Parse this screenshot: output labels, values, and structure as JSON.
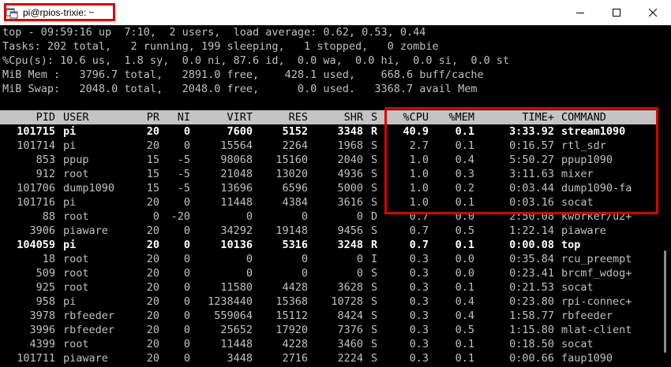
{
  "window": {
    "title": "pi@rpios-trixie: ~",
    "icons": {
      "app": "terminal-app-icon",
      "minimize": "minimize-icon",
      "maximize": "maximize-icon",
      "close": "close-icon"
    }
  },
  "summary": [
    "top - 09:59:16 up  7:10,  2 users,  load average: 0.62, 0.53, 0.44",
    "Tasks: 202 total,   2 running, 199 sleeping,   1 stopped,   0 zombie",
    "%Cpu(s): 10.6 us,  1.8 sy,  0.0 ni, 87.6 id,  0.0 wa,  0.0 hi,  0.0 si,  0.0 st",
    "MiB Mem :   3796.7 total,   2891.0 free,    428.1 used,    668.6 buff/cache",
    "MiB Swap:   2048.0 total,   2048.0 free,      0.0 used.   3368.7 avail Mem"
  ],
  "table": {
    "columns": [
      "PID",
      "USER",
      "PR",
      "NI",
      "VIRT",
      "RES",
      "SHR",
      "S",
      "%CPU",
      "%MEM",
      "TIME+",
      "COMMAND"
    ],
    "rows": [
      {
        "pid": "101715",
        "user": "pi",
        "pr": "20",
        "ni": "0",
        "virt": "7600",
        "res": "5152",
        "shr": "3348",
        "s": "R",
        "cpu": "40.9",
        "mem": "0.1",
        "time": "3:33.92",
        "cmd": "stream1090",
        "bold": true
      },
      {
        "pid": "101714",
        "user": "pi",
        "pr": "20",
        "ni": "0",
        "virt": "15564",
        "res": "2264",
        "shr": "1968",
        "s": "S",
        "cpu": "2.7",
        "mem": "0.1",
        "time": "0:16.57",
        "cmd": "rtl_sdr",
        "bold": false
      },
      {
        "pid": "853",
        "user": "ppup",
        "pr": "15",
        "ni": "-5",
        "virt": "98068",
        "res": "15160",
        "shr": "2040",
        "s": "S",
        "cpu": "1.0",
        "mem": "0.4",
        "time": "5:50.27",
        "cmd": "ppup1090",
        "bold": false
      },
      {
        "pid": "912",
        "user": "root",
        "pr": "15",
        "ni": "-5",
        "virt": "21048",
        "res": "13020",
        "shr": "4936",
        "s": "S",
        "cpu": "1.0",
        "mem": "0.3",
        "time": "3:11.63",
        "cmd": "mixer",
        "bold": false
      },
      {
        "pid": "101706",
        "user": "dump1090",
        "pr": "15",
        "ni": "-5",
        "virt": "13696",
        "res": "6596",
        "shr": "5000",
        "s": "S",
        "cpu": "1.0",
        "mem": "0.2",
        "time": "0:03.44",
        "cmd": "dump1090-fa",
        "bold": false
      },
      {
        "pid": "101716",
        "user": "pi",
        "pr": "20",
        "ni": "0",
        "virt": "11448",
        "res": "4384",
        "shr": "3616",
        "s": "S",
        "cpu": "1.0",
        "mem": "0.1",
        "time": "0:03.16",
        "cmd": "socat",
        "bold": false
      },
      {
        "pid": "88",
        "user": "root",
        "pr": "0",
        "ni": "-20",
        "virt": "0",
        "res": "0",
        "shr": "0",
        "s": "D",
        "cpu": "0.7",
        "mem": "0.0",
        "time": "2:50.08",
        "cmd": "kworker/u2+",
        "bold": false
      },
      {
        "pid": "3906",
        "user": "piaware",
        "pr": "20",
        "ni": "0",
        "virt": "34292",
        "res": "19148",
        "shr": "9456",
        "s": "S",
        "cpu": "0.7",
        "mem": "0.5",
        "time": "1:22.14",
        "cmd": "piaware",
        "bold": false
      },
      {
        "pid": "104059",
        "user": "pi",
        "pr": "20",
        "ni": "0",
        "virt": "10136",
        "res": "5316",
        "shr": "3248",
        "s": "R",
        "cpu": "0.7",
        "mem": "0.1",
        "time": "0:00.08",
        "cmd": "top",
        "bold": true
      },
      {
        "pid": "18",
        "user": "root",
        "pr": "20",
        "ni": "0",
        "virt": "0",
        "res": "0",
        "shr": "0",
        "s": "I",
        "cpu": "0.3",
        "mem": "0.0",
        "time": "0:35.84",
        "cmd": "rcu_preempt",
        "bold": false
      },
      {
        "pid": "509",
        "user": "root",
        "pr": "20",
        "ni": "0",
        "virt": "0",
        "res": "0",
        "shr": "0",
        "s": "S",
        "cpu": "0.3",
        "mem": "0.0",
        "time": "0:23.41",
        "cmd": "brcmf_wdog+",
        "bold": false
      },
      {
        "pid": "925",
        "user": "root",
        "pr": "20",
        "ni": "0",
        "virt": "11580",
        "res": "4428",
        "shr": "3628",
        "s": "S",
        "cpu": "0.3",
        "mem": "0.1",
        "time": "0:21.53",
        "cmd": "socat",
        "bold": false
      },
      {
        "pid": "958",
        "user": "pi",
        "pr": "20",
        "ni": "0",
        "virt": "1238440",
        "res": "15368",
        "shr": "10728",
        "s": "S",
        "cpu": "0.3",
        "mem": "0.4",
        "time": "0:23.80",
        "cmd": "rpi-connec+",
        "bold": false
      },
      {
        "pid": "3978",
        "user": "rbfeeder",
        "pr": "20",
        "ni": "0",
        "virt": "559064",
        "res": "15112",
        "shr": "8424",
        "s": "S",
        "cpu": "0.3",
        "mem": "0.4",
        "time": "1:58.77",
        "cmd": "rbfeeder",
        "bold": false
      },
      {
        "pid": "3996",
        "user": "rbfeeder",
        "pr": "20",
        "ni": "0",
        "virt": "25652",
        "res": "17920",
        "shr": "7376",
        "s": "S",
        "cpu": "0.3",
        "mem": "0.5",
        "time": "1:15.80",
        "cmd": "mlat-client",
        "bold": false
      },
      {
        "pid": "4399",
        "user": "root",
        "pr": "20",
        "ni": "0",
        "virt": "11448",
        "res": "4228",
        "shr": "3460",
        "s": "S",
        "cpu": "0.3",
        "mem": "0.1",
        "time": "0:18.50",
        "cmd": "socat",
        "bold": false
      },
      {
        "pid": "101711",
        "user": "piaware",
        "pr": "20",
        "ni": "0",
        "virt": "3448",
        "res": "2716",
        "shr": "2224",
        "s": "S",
        "cpu": "0.3",
        "mem": "0.1",
        "time": "0:00.66",
        "cmd": "faup1090",
        "bold": false
      }
    ]
  },
  "colors": {
    "highlight": "#e00000",
    "header_bar": "#c4c4c4",
    "terminal_bg": "#000000",
    "terminal_fg": "#c0c0c0"
  }
}
